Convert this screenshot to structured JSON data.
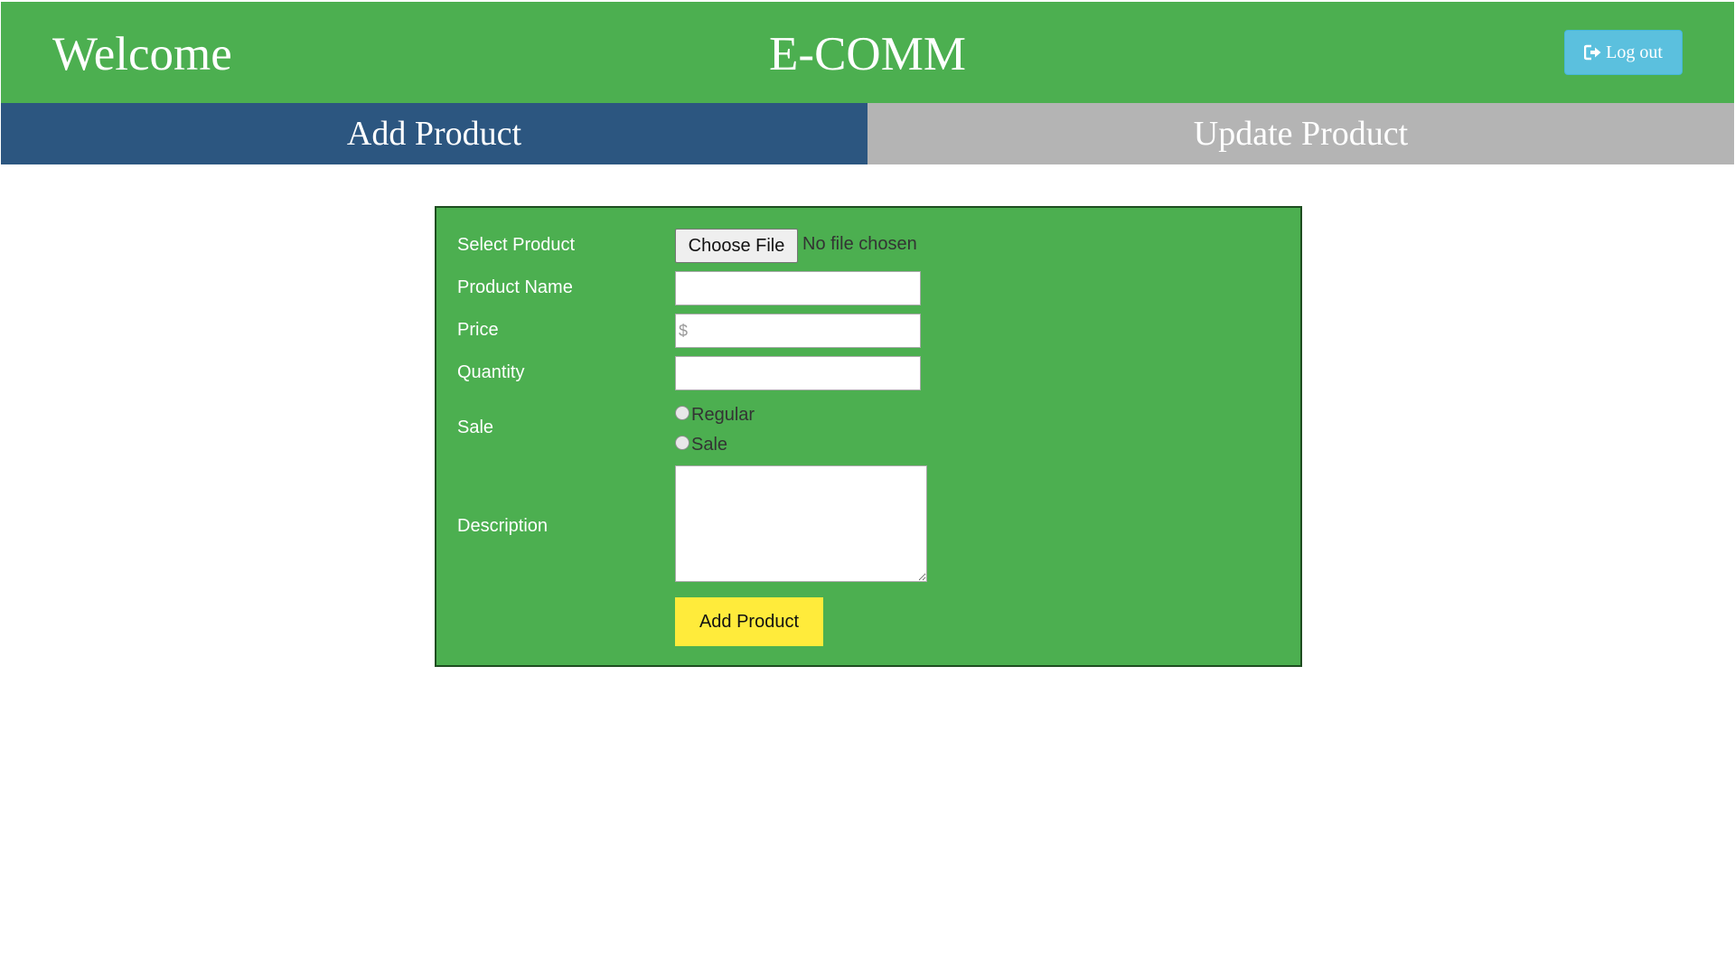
{
  "header": {
    "welcome": "Welcome",
    "brand": "E-COMM",
    "logout_label": "Log out",
    "logout_icon": "sign-out-icon",
    "background": "#4caf50"
  },
  "tabs": [
    {
      "label": "Add Product",
      "active": true,
      "color": "#2c5680"
    },
    {
      "label": "Update Product",
      "active": false,
      "color": "#b4b4b4"
    }
  ],
  "form": {
    "select_product": {
      "label": "Select Product",
      "button_label": "Choose File",
      "status_text": "No file chosen"
    },
    "product_name": {
      "label": "Product Name",
      "value": ""
    },
    "price": {
      "label": "Price",
      "value": "",
      "placeholder": "$"
    },
    "quantity": {
      "label": "Quantity",
      "value": ""
    },
    "sale": {
      "label": "Sale",
      "options": [
        {
          "label": "Regular",
          "checked": false
        },
        {
          "label": "Sale",
          "checked": false
        }
      ]
    },
    "description": {
      "label": "Description",
      "value": ""
    },
    "submit_label": "Add Product",
    "submit_color": "#ffeb3b"
  }
}
